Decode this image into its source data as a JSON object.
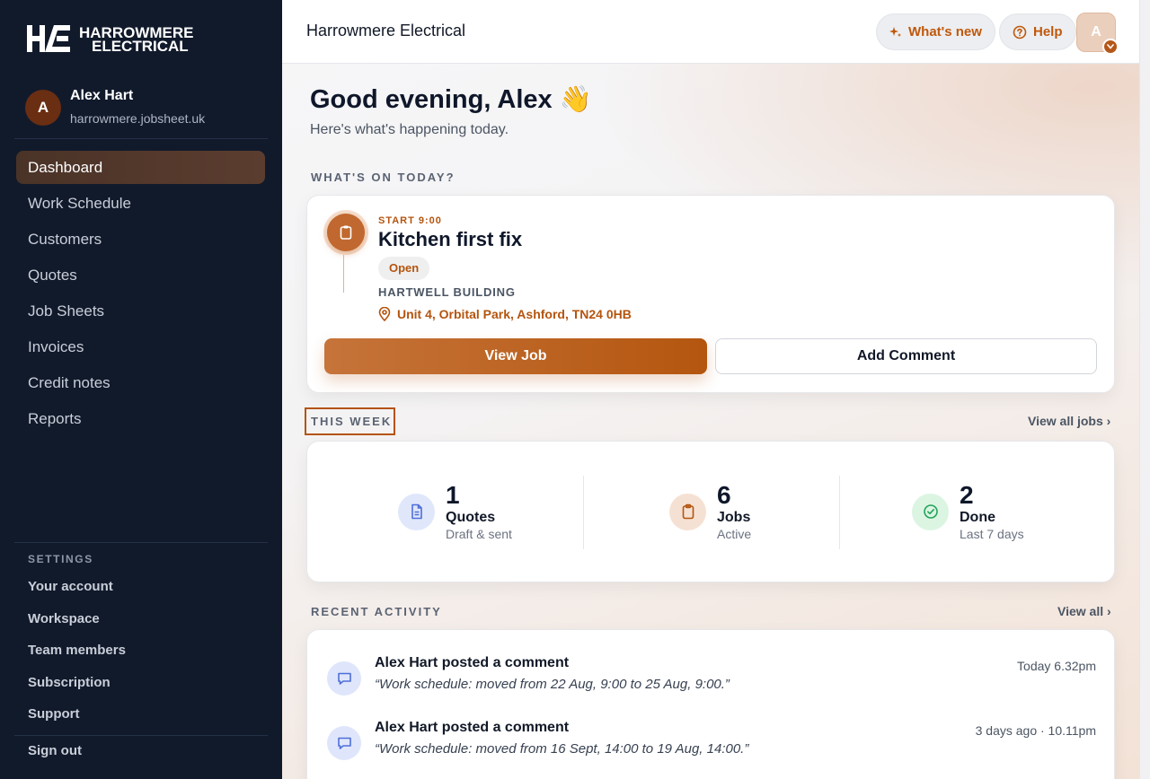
{
  "brand": {
    "line1": "HARROWMERE",
    "line2": "ELECTRICAL"
  },
  "user": {
    "initial": "A",
    "name": "Alex Hart",
    "domain": "harrowmere.jobsheet.uk"
  },
  "nav": [
    {
      "label": "Dashboard"
    },
    {
      "label": "Work Schedule"
    },
    {
      "label": "Customers"
    },
    {
      "label": "Quotes"
    },
    {
      "label": "Job Sheets"
    },
    {
      "label": "Invoices"
    },
    {
      "label": "Credit notes"
    },
    {
      "label": "Reports"
    }
  ],
  "settings": {
    "title": "SETTINGS",
    "items": [
      "Your account",
      "Workspace",
      "Team members",
      "Subscription",
      "Support"
    ],
    "signout": "Sign out"
  },
  "topbar": {
    "title": "Harrowmere Electrical",
    "whats_new": "What's new",
    "help": "Help",
    "avatar_initial": "A"
  },
  "greeting": {
    "title": "Good evening, Alex 👋",
    "subtitle": "Here's what's happening today."
  },
  "today": {
    "section_label": "WHAT'S ON TODAY?",
    "start": "START 9:00",
    "title": "Kitchen first fix",
    "status": "Open",
    "company": "HARTWELL BUILDING",
    "address": "Unit 4, Orbital Park, Ashford, TN24 0HB",
    "view_job": "View Job",
    "add_comment": "Add Comment"
  },
  "week": {
    "section_label": "THIS WEEK",
    "view_all": "View all jobs ›",
    "stats": [
      {
        "value": "1",
        "label": "Quotes",
        "sub": "Draft & sent",
        "color": "#e0e7fb"
      },
      {
        "value": "6",
        "label": "Jobs",
        "sub": "Active",
        "color": "#f5e1d3"
      },
      {
        "value": "2",
        "label": "Done",
        "sub": "Last 7 days",
        "color": "#dcf5e3"
      }
    ]
  },
  "activity": {
    "section_label": "RECENT ACTIVITY",
    "view_all": "View all ›",
    "items": [
      {
        "title": "Alex Hart posted a comment",
        "quote": "“Work schedule: moved from 22 Aug, 9:00 to 25 Aug, 9:00.”",
        "time": "Today 6.32pm"
      },
      {
        "title": "Alex Hart posted a comment",
        "quote": "“Work schedule: moved from 16 Sept, 14:00 to 19 Aug, 14:00.”",
        "time": "3 days ago · 10.11pm"
      }
    ]
  },
  "colors": {
    "accent": "#b4540e",
    "sidebar": "#111a2b"
  }
}
